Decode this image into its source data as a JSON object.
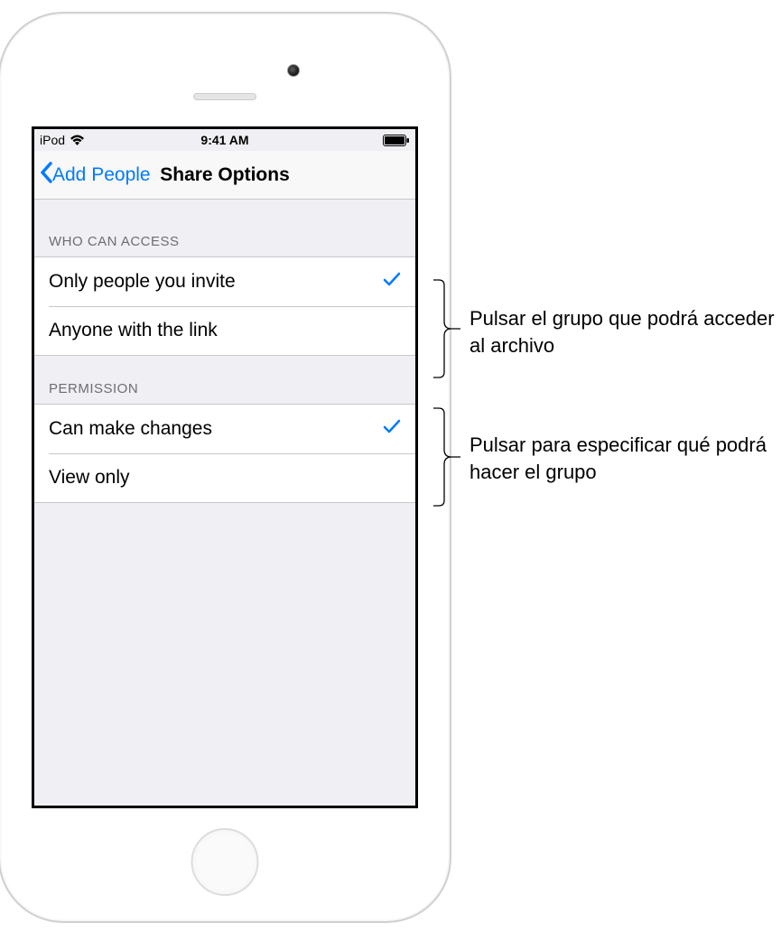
{
  "status": {
    "carrier": "iPod",
    "time": "9:41 AM"
  },
  "nav": {
    "back_label": "Add People",
    "title": "Share Options"
  },
  "sections": {
    "access": {
      "header": "WHO CAN ACCESS",
      "options": [
        {
          "label": "Only people you invite",
          "selected": true
        },
        {
          "label": "Anyone with the link",
          "selected": false
        }
      ]
    },
    "permission": {
      "header": "PERMISSION",
      "options": [
        {
          "label": "Can make changes",
          "selected": true
        },
        {
          "label": "View only",
          "selected": false
        }
      ]
    }
  },
  "callouts": {
    "access": "Pulsar el grupo que podrá acceder al archivo",
    "permission": "Pulsar para especificar qué podrá hacer el grupo"
  }
}
